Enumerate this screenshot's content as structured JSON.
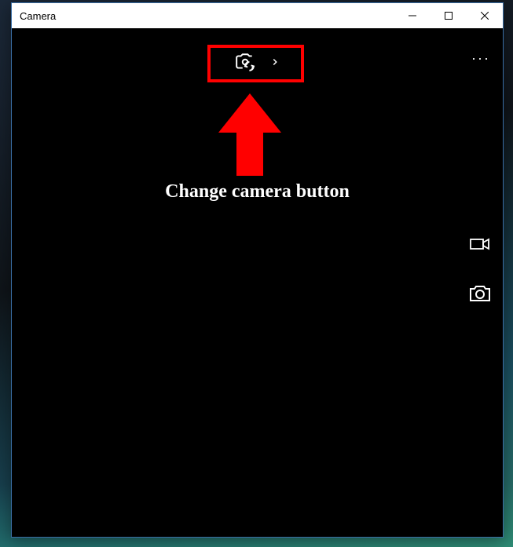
{
  "window": {
    "title": "Camera"
  },
  "toolbar": {
    "change_camera_icon": "camera-switch",
    "expand_icon": "chevron-right",
    "more_icon": "more-horizontal"
  },
  "side": {
    "video_icon": "video-camera",
    "photo_icon": "photo-camera"
  },
  "annotation": {
    "label": "Change camera button",
    "highlight_color": "#ff0000",
    "arrow_color": "#ff0000"
  }
}
